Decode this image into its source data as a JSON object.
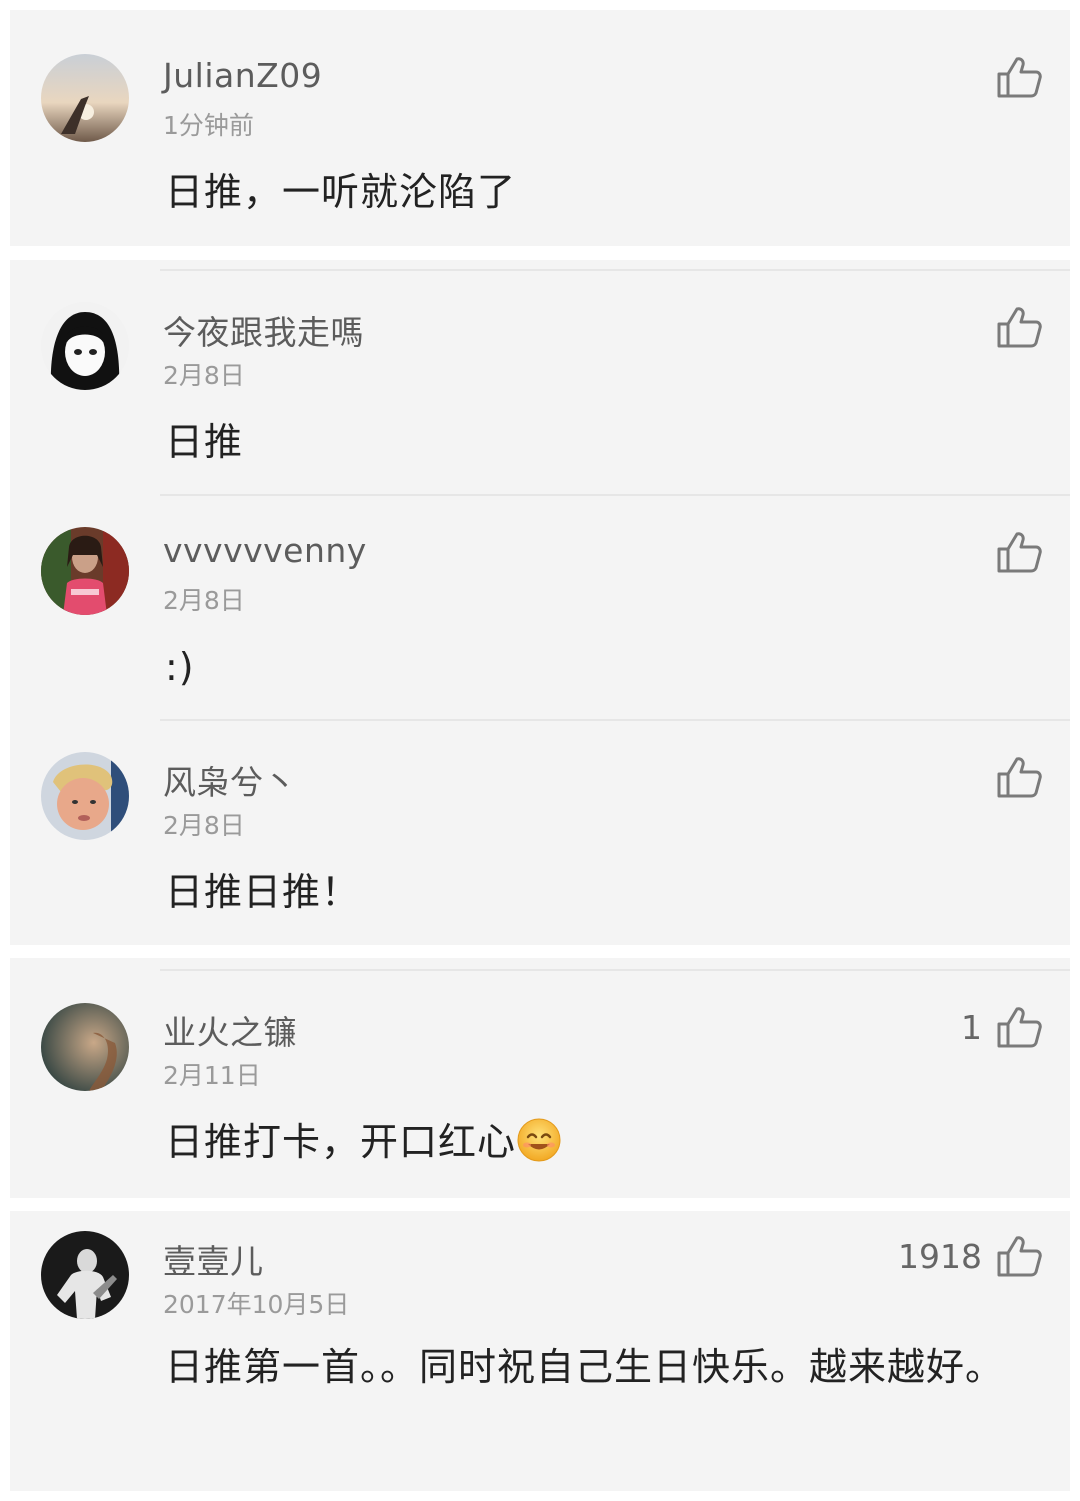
{
  "comments": [
    {
      "username": "JulianZ09",
      "time": "1分钟前",
      "text": "日推，一听就沦陷了",
      "likes": ""
    },
    {
      "username": "今夜跟我走嗎",
      "time": "2月8日",
      "text": "日推",
      "likes": ""
    },
    {
      "username": "vvvvvvenny",
      "time": "2月8日",
      "text": ":)",
      "likes": ""
    },
    {
      "username": "风枭兮丶",
      "time": "2月8日",
      "text": "日推日推！",
      "likes": ""
    },
    {
      "username": "业火之镰",
      "time": "2月11日",
      "text": "日推打卡，开口红心",
      "likes": "1",
      "emoji": "smile-emoji"
    },
    {
      "username": "壹壹儿",
      "time": "2017年10月5日",
      "text": "日推第一首。。同时祝自己生日快乐。越来越好。",
      "likes": "1918"
    }
  ],
  "icons": {
    "like": "thumbs-up-icon"
  },
  "colors": {
    "card_bg": "#f4f4f4",
    "page_bg": "#ffffff",
    "text": "#222222",
    "meta": "#9a9a9a"
  }
}
